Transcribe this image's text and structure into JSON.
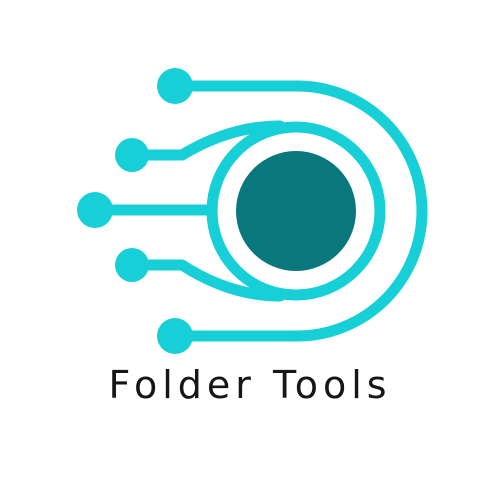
{
  "brand": {
    "name": "Folder Tools"
  },
  "colors": {
    "accent": "#17CFD6",
    "core": "#08787C",
    "text": "#161616",
    "background": "#FFFFFF"
  },
  "icons": {
    "mark": "circuit-disc-logo-icon"
  }
}
